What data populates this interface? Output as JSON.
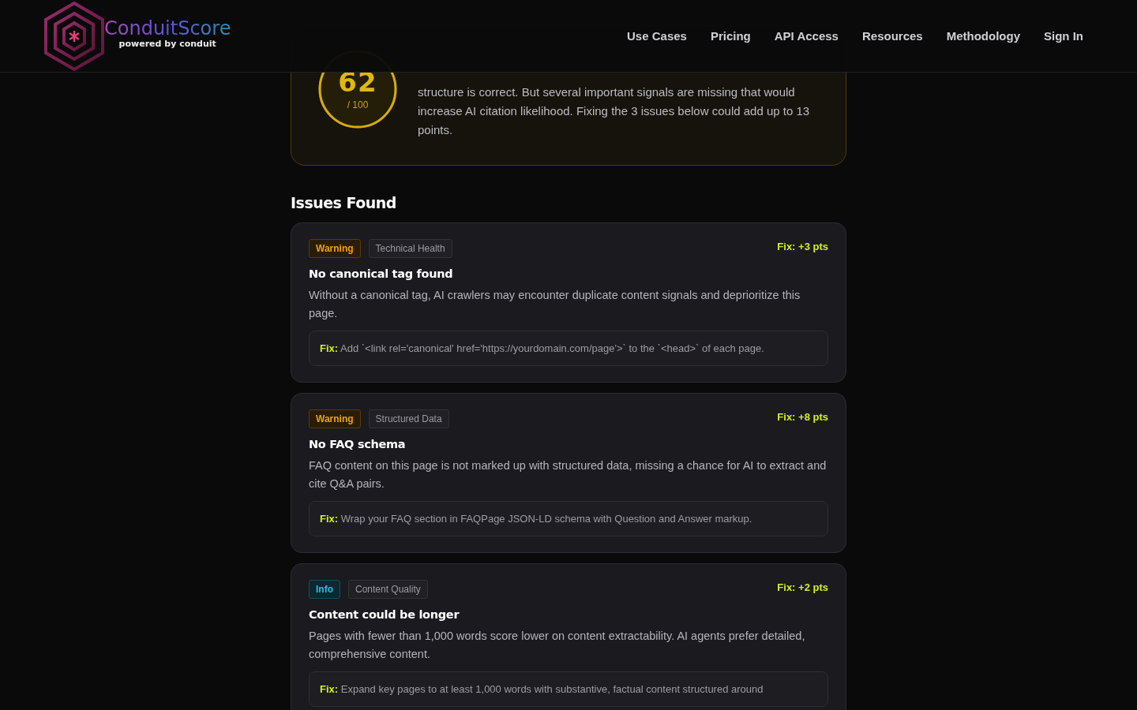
{
  "header": {
    "logo": {
      "name": "ConduitScore",
      "tagline": "powered by conduit"
    },
    "nav": [
      {
        "label": "Use Cases"
      },
      {
        "label": "Pricing"
      },
      {
        "label": "API Access"
      },
      {
        "label": "Resources"
      },
      {
        "label": "Methodology"
      },
      {
        "label": "Sign In"
      }
    ]
  },
  "score_card": {
    "score": "62",
    "out_of": "/ 100",
    "summary": "structure is correct. But several important signals are missing that would increase AI citation likelihood. Fixing the 3 issues below could add up to 13 points."
  },
  "issues_heading": "Issues Found",
  "issues": [
    {
      "severity": {
        "kind": "warning",
        "label": "Warning"
      },
      "category": "Technical Health",
      "points": "Fix: +3 pts",
      "title": "No canonical tag found",
      "description": "Without a canonical tag, AI crawlers may encounter duplicate content signals and deprioritize this page.",
      "fix_label": "Fix:",
      "fix": "Add `<link rel='canonical' href='https://yourdomain.com/page'>` to the `<head>` of each page."
    },
    {
      "severity": {
        "kind": "warning",
        "label": "Warning"
      },
      "category": "Structured Data",
      "points": "Fix: +8 pts",
      "title": "No FAQ schema",
      "description": "FAQ content on this page is not marked up with structured data, missing a chance for AI to extract and cite Q&A pairs.",
      "fix_label": "Fix:",
      "fix": "Wrap your FAQ section in FAQPage JSON-LD schema with Question and Answer markup."
    },
    {
      "severity": {
        "kind": "info",
        "label": "Info"
      },
      "category": "Content Quality",
      "points": "Fix: +2 pts",
      "title": "Content could be longer",
      "description": "Pages with fewer than 1,000 words score lower on content extractability. AI agents prefer detailed, comprehensive content.",
      "fix_label": "Fix:",
      "fix": "Expand key pages to at least 1,000 words with substantive, factual content structured around"
    }
  ]
}
